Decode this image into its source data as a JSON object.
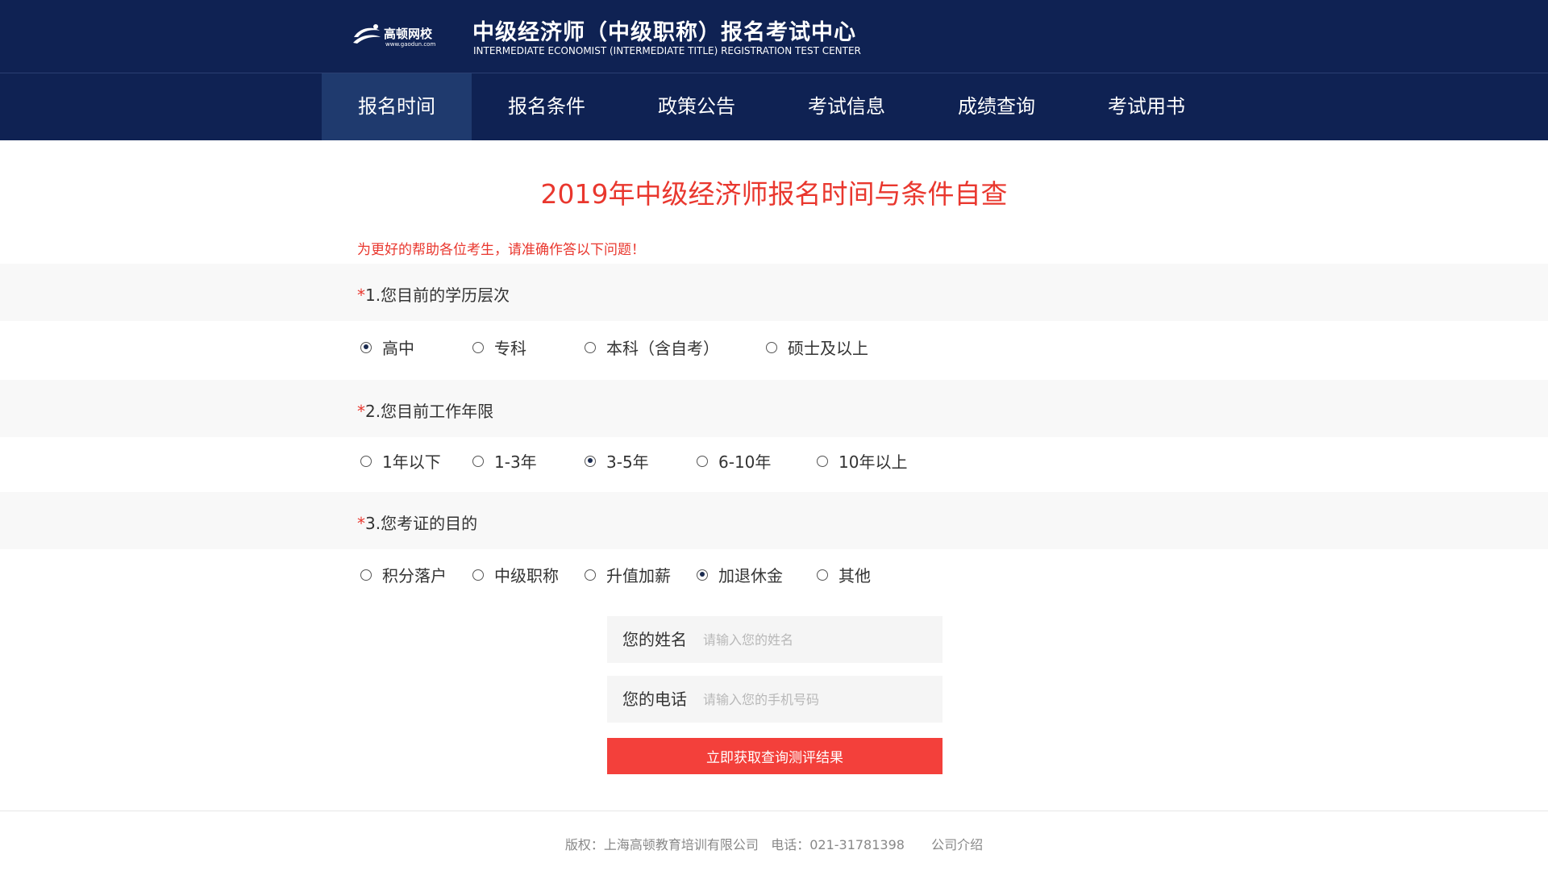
{
  "colors": {
    "header_bg": "#0f2253",
    "nav_active_bg": "#1f3a6e",
    "accent_red": "#e9372e",
    "button_red": "#f3403b",
    "band_gray": "#f8f8f8"
  },
  "header": {
    "logo_icon": "gaodun-logo-icon",
    "logo_name": "高顿网校",
    "logo_url": "www.gaodun.com",
    "title": "中级经济师（中级职称）报名考试中心",
    "subtitle": "INTERMEDIATE ECONOMIST (INTERMEDIATE TITLE) REGISTRATION TEST CENTER"
  },
  "nav": {
    "active_index": 0,
    "items": [
      {
        "label": "报名时间"
      },
      {
        "label": "报名条件"
      },
      {
        "label": "政策公告"
      },
      {
        "label": "考试信息"
      },
      {
        "label": "成绩查询"
      },
      {
        "label": "考试用书"
      }
    ]
  },
  "main": {
    "title": "2019年中级经济师报名时间与条件自查",
    "notice": "为更好的帮助各位考生，请准确作答以下问题！",
    "required_mark": "*",
    "questions": [
      {
        "text": "1.您目前的学历层次",
        "selected_index": 0,
        "options": [
          {
            "label": "高中"
          },
          {
            "label": "专科"
          },
          {
            "label": "本科（含自考）"
          },
          {
            "label": "硕士及以上"
          }
        ]
      },
      {
        "text": "2.您目前工作年限",
        "selected_index": 2,
        "options": [
          {
            "label": "1年以下"
          },
          {
            "label": "1-3年"
          },
          {
            "label": "3-5年"
          },
          {
            "label": "6-10年"
          },
          {
            "label": "10年以上"
          }
        ]
      },
      {
        "text": "3.您考证的目的",
        "selected_index": 3,
        "options": [
          {
            "label": "积分落户"
          },
          {
            "label": "中级职称"
          },
          {
            "label": "升值加薪"
          },
          {
            "label": "加退休金"
          },
          {
            "label": "其他"
          }
        ]
      }
    ],
    "form": {
      "name_label": "您的姓名",
      "name_placeholder": "请输入您的姓名",
      "name_value": "",
      "phone_label": "您的电话",
      "phone_placeholder": "请输入您的手机号码",
      "phone_value": "",
      "submit_label": "立即获取查询测评结果"
    }
  },
  "footer": {
    "copyright": "版权：上海高顿教育培训有限公司",
    "phone": "电话：021-31781398",
    "about_link": "公司介绍"
  }
}
